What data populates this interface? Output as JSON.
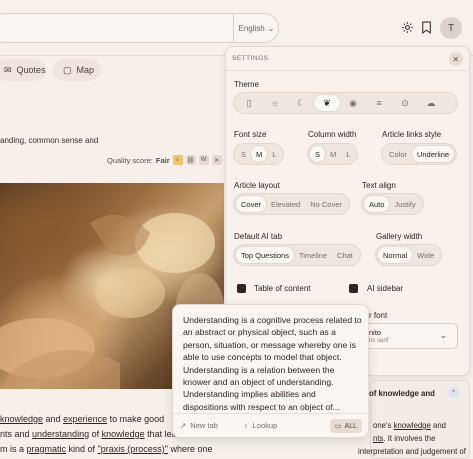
{
  "header": {
    "language": "English",
    "avatar_letter": "T"
  },
  "tabs": {
    "quotes": "Quotes",
    "map": "Map"
  },
  "article": {
    "intro_line": "anding, common sense and",
    "quality_label": "Quality score:",
    "quality_value": "Fair",
    "lines": [
      {
        "parts": [
          {
            "t": "knowledge",
            "u": true
          },
          {
            "t": " and "
          },
          {
            "t": "experience",
            "u": true
          },
          {
            "t": " to make good"
          }
        ]
      },
      {
        "parts": [
          {
            "t": "nts and "
          },
          {
            "t": "understanding",
            "u": true
          },
          {
            "t": " of "
          },
          {
            "t": "knowledge",
            "u": true
          },
          {
            "t": " that lea"
          }
        ]
      },
      {
        "parts": [
          {
            "t": "m is a "
          },
          {
            "t": "pragmatic",
            "u": true
          },
          {
            "t": " kind of "
          },
          {
            "t": "\"praxis (process)\"",
            "u": true
          },
          {
            "t": " where one"
          }
        ]
      }
    ]
  },
  "settings": {
    "title": "SETTINGS",
    "theme_label": "Theme",
    "theme_icons": [
      "phone-icon",
      "sun-icon",
      "moon-icon",
      "leaf-icon",
      "eye-icon",
      "bars-icon",
      "download-icon",
      "cloud-icon"
    ],
    "theme_selected": 3,
    "font_size": {
      "label": "Font size",
      "options": [
        "S",
        "M",
        "L"
      ],
      "selected": 1
    },
    "column_width": {
      "label": "Column width",
      "options": [
        "S",
        "M",
        "L"
      ],
      "selected": 0
    },
    "links_style": {
      "label": "Article links style",
      "options": [
        "Color",
        "Underline"
      ],
      "selected": 1
    },
    "layout": {
      "label": "Article layout",
      "options": [
        "Cover",
        "Elevated",
        "No Cover"
      ],
      "selected": 0
    },
    "text_align": {
      "label": "Text align",
      "options": [
        "Auto",
        "Justify"
      ],
      "selected": 0
    },
    "ai_tab": {
      "label": "Default AI tab",
      "options": [
        "Top Questions",
        "Timeline",
        "Chat"
      ],
      "selected": 0
    },
    "gallery": {
      "label": "Gallery width",
      "options": [
        "Normal",
        "Wide"
      ],
      "selected": 0
    },
    "toc_label": "Table of content",
    "ai_sidebar_label": "AI sidebar",
    "font_label_partial": "r font",
    "font_value_partial": "nito",
    "font_sub_partial": "ns serif"
  },
  "popup": {
    "text": "Understanding is a cognitive process related to an abstract or physical object, such as a person, situation, or message whereby one is able to use concepts to model that object. Understanding is a relation between the knower and an object of understanding. Understanding implies abilities and dispositions with respect to an object of...",
    "new_tab": "New tab",
    "lookup": "Lookup",
    "all": "ALL"
  },
  "sidebar_card": {
    "title_partial": "of knowledge and",
    "line1_pre": "one's ",
    "line1_link": "knowledge",
    "line1_post": " and",
    "line2_link": "nts",
    "line2_post": ". It involves the",
    "line3": "interpretation and judgement of"
  }
}
